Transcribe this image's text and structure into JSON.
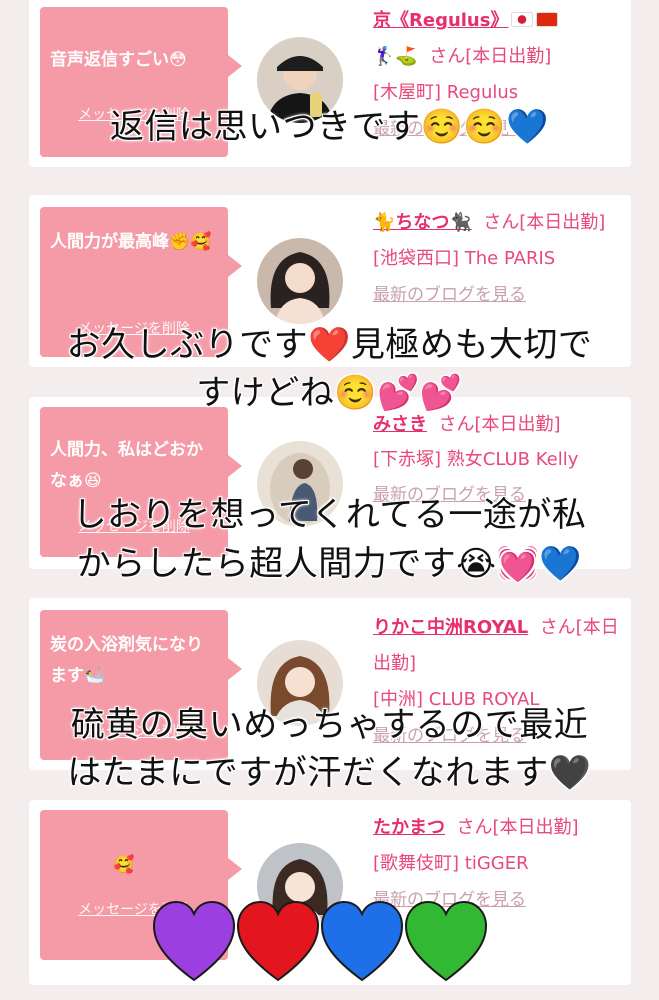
{
  "cards": [
    {
      "bubble": "音声返信すごい😳",
      "delete_label": "メッセージを削除",
      "name": "京《Regulus》",
      "name_emoji": "🏌️‍♀️⛳️",
      "san": "さん[本日出勤]",
      "shop": "[木屋町] Regulus",
      "blog": "最新のブログを見る"
    },
    {
      "bubble": "人間力が最高峰✊🥰",
      "delete_label": "メッセージを削除",
      "name": "🐈ちなつ🐈‍⬛",
      "san": "さん[本日出勤]",
      "shop": "[池袋西口] The PARIS",
      "blog": "最新のブログを見る"
    },
    {
      "bubble": "人間力、私はどおかなぁ😆",
      "delete_label": "メッセージを削除",
      "name": "みさき",
      "san": "さん[本日出勤]",
      "shop": "[下赤塚] 熟女CLUB Kelly",
      "blog": "最新のブログを見る"
    },
    {
      "bubble": "炭の入浴剤気になります🛀",
      "delete_label": "メッセージを削除",
      "name": "りかこ中洲ROYAL",
      "san": "さん[本日出勤]",
      "shop": "[中洲] CLUB ROYAL",
      "blog": "最新のブログを見る"
    },
    {
      "bubble": "🥰",
      "delete_label": "メッセージを削除",
      "name": "たかまつ",
      "san": "さん[本日出勤]",
      "shop": "[歌舞伎町] tiGGER",
      "blog": "最新のブログを見る"
    }
  ],
  "overlay": {
    "line1": "返信は思いつきです☺️☺️💙",
    "line2a": "お久しぶりです❤️見極めも大切で",
    "line2b": "すけどね☺️💕💕",
    "line3a": "しおりを想ってくれてる一途が私",
    "line3b": "からしたら超人間力です😭💓💙",
    "line4a": "硫黄の臭いめっちゃするので最近",
    "line4b": "はたまにですが汗だくなれます🖤"
  },
  "colors": {
    "bubble": "#f59aa7",
    "name": "#e5306b",
    "text": "#e8497a",
    "background": "#f3eded"
  },
  "icons": [
    "purple-heart-icon",
    "red-heart-icon",
    "blue-heart-icon",
    "green-heart-icon"
  ]
}
